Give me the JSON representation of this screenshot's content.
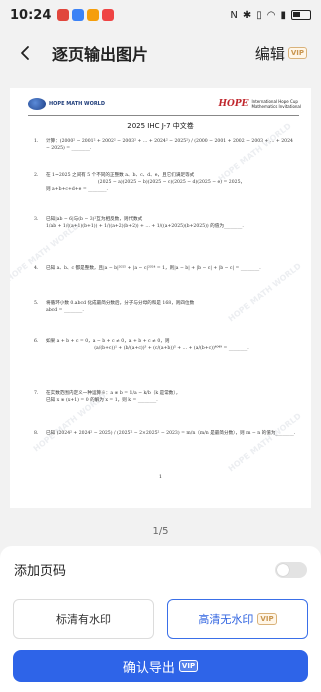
{
  "status_bar": {
    "time": "10:24",
    "battery": "41"
  },
  "nav": {
    "title": "逐页输出图片",
    "edit_label": "编辑",
    "vip_badge": "VIP"
  },
  "document": {
    "logo_text": "HOPE MATH WORLD",
    "cup_logo_mark": "HOPE",
    "cup_logo_line1": "International Hope Cup",
    "cup_logo_line2": "Mathematics Invitational",
    "title": "2025 IHC J-7  中文卷",
    "watermark": "HOPE MATH WORLD",
    "page_number": "1",
    "problems": [
      {
        "num": "1.",
        "lines": [
          "计算：(2000² − 2001² + 2002² − 2003² + … + 2024² − 2025²) / (2000 − 2001 + 2002 − 2003 + … + 2024 − 2025) = ________."
        ]
      },
      {
        "num": "2.",
        "lines": [
          "在 1~2025 之间有 5 个不同的正整数 a、b、c、d、e，且它们满足等式",
          "(2025 − a)(2025 − b)(2025 − c)(2025 − d)(2025 − e) = 2025，",
          "则 a+b+c+d+e = ________."
        ]
      },
      {
        "num": "3.",
        "lines": [
          "已知|ab − 6|与(b − 3)²互为相反数，则代数式",
          "1/ab + 1/((a+1)(b+1)) + 1/((a+2)(b+2)) + … + 1/((a+2025)(b+2025)) 的值为________."
        ]
      },
      {
        "num": "4.",
        "lines": [
          "已知 a、b、c 都是整数，且|a − b|²⁰²⁵ + |a − c|²⁰²⁴ = 1，则|a − b| + |b − c| + |b − c| = ________."
        ]
      },
      {
        "num": "5.",
        "lines": [
          "将循环小数 0.abcd 化成最简分数后，分子与分母的和是 168，则四位数",
          "abcd = ________."
        ]
      },
      {
        "num": "6.",
        "lines": [
          "如果 a + b + c = 0，a − b + c ≠ 0，a + b + c ≠ 0，则",
          "(a/(b+c))¹ + (b/(a+c))³ + (c/(a+b))⁵ + … + (a/(b+c))⁴⁰⁴⁹ = ________."
        ]
      },
      {
        "num": "7.",
        "lines": [
          "在实数范围内定义一种运算※：a ※ b = 1/a − k/b（k 是常数），",
          "已知 x ※ (x+1) = 0 的解为 x = 1，则 k = ________."
        ]
      },
      {
        "num": "8.",
        "lines": [
          "已知 (2024² + 2024² − 2025) / (2025² − 2×2025² − 2023) = m/n（m/n 是最简分数），则 m − n 的值为________."
        ]
      }
    ]
  },
  "page_indicator": "1/5",
  "options": {
    "add_page_number_label": "添加页码",
    "add_page_number_on": false,
    "standard_label": "标清有水印",
    "hd_label": "高清无水印",
    "hd_badge": "VIP"
  },
  "confirm": {
    "label": "确认导出",
    "badge": "VIP"
  },
  "colors": {
    "accent": "#2e64e8",
    "vip": "#c9954e",
    "logo_red": "#c0272d"
  }
}
